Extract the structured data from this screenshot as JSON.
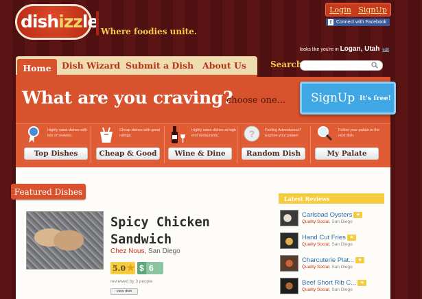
{
  "header": {
    "logo_main": "dish",
    "logo_accent": "izz",
    "logo_tail": "le",
    "tagline": "Where foodies unite.",
    "login": "Login",
    "signup": "SignUp",
    "facebook": "Connect with Facebook",
    "location_prefix": "looks like you're in",
    "location": "Logan, Utah",
    "location_edit": "edit"
  },
  "nav": {
    "items": [
      {
        "label": "Home",
        "active": true
      },
      {
        "label": "Dish Wizard"
      },
      {
        "label": "Submit a Dish"
      },
      {
        "label": "About Us"
      }
    ],
    "search_label": "Search:",
    "search_value": ""
  },
  "hero": {
    "title": "What are you craving?",
    "subtitle": "choose one...",
    "cta_label": "SignUp",
    "cta_free": "It's free!"
  },
  "options": [
    {
      "icon": "ribbon-award-icon",
      "desc": "Highly rated dishes with lots of reviews.",
      "button": "Top Dishes"
    },
    {
      "icon": "takeout-box-icon",
      "desc": "Cheap dishes with great ratings.",
      "button": "Cheap & Good"
    },
    {
      "icon": "wine-bottle-icon",
      "desc": "Highly rated dishes at high end restaurants.",
      "button": "Wine & Dine"
    },
    {
      "icon": "question-mark-icon",
      "desc": "Feeling Adventurous? Explore your palate!",
      "button": "Random Dish"
    },
    {
      "icon": "magnifier-icon",
      "desc": "Follow your palate to the next dish.",
      "button": "My Palate"
    }
  ],
  "featured": {
    "tab": "Featured Dishes",
    "title": "Spicy Chicken Sandwich",
    "restaurant": "Chez Nous",
    "city": ", San Diego",
    "rating": "5.0",
    "price_symbol": "$",
    "price": "6",
    "reviewed": "reviewed by 3 people",
    "view": "view dish"
  },
  "latest_reviews": {
    "header": "Latest Reviews",
    "items": [
      {
        "name": "Carlsbad Oysters",
        "quality": "Quality Social",
        "city": ", San Diego"
      },
      {
        "name": "Hand Cut Fries",
        "quality": "Quality Social",
        "city": ", San Diego"
      },
      {
        "name": "Charcuterie Plat...",
        "quality": "Quality Social",
        "city": ", San Diego"
      },
      {
        "name": "Beef Short Rib C...",
        "quality": "Quality Social",
        "city": ", San Diego"
      }
    ]
  },
  "colors": {
    "brand_red": "#d9522e",
    "accent_yellow": "#f5cc3f",
    "cta_blue": "#3fa7e3"
  }
}
